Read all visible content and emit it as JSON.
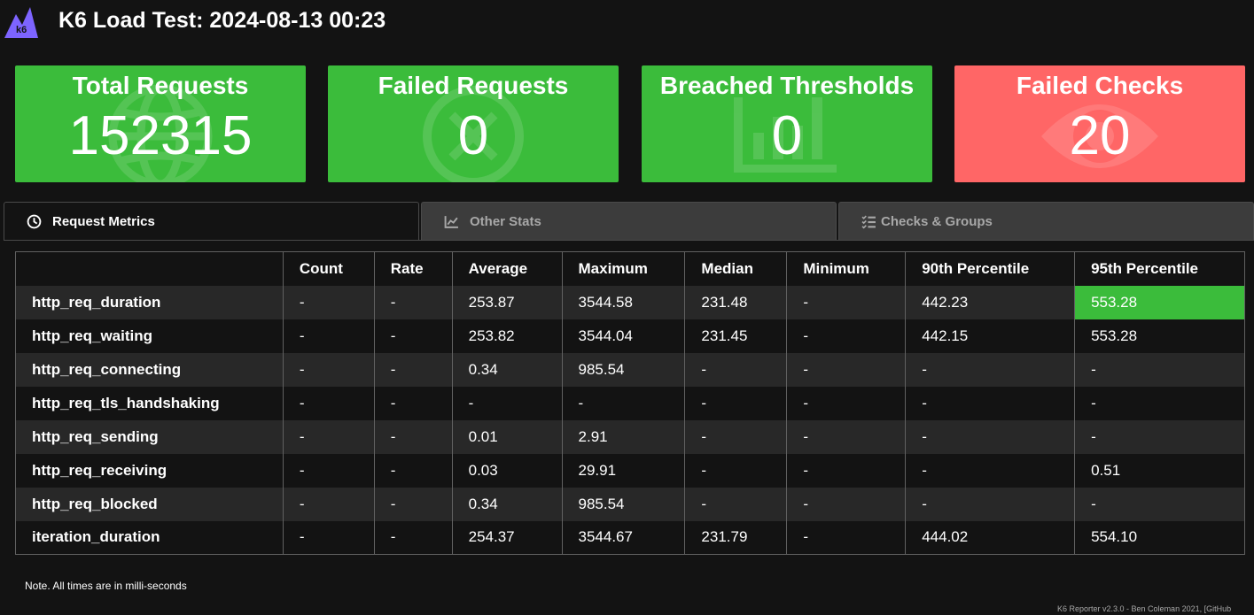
{
  "header": {
    "logo_text": "k6",
    "title": "K6 Load Test: 2024-08-13 00:23"
  },
  "cards": [
    {
      "title": "Total Requests",
      "value": "152315",
      "icon": "globe-icon",
      "status": "ok"
    },
    {
      "title": "Failed Requests",
      "value": "0",
      "icon": "x-circle-icon",
      "status": "ok"
    },
    {
      "title": "Breached Thresholds",
      "value": "0",
      "icon": "bar-chart-icon",
      "status": "ok"
    },
    {
      "title": "Failed Checks",
      "value": "20",
      "icon": "eye-icon",
      "status": "fail"
    }
  ],
  "tabs": [
    {
      "label": "Request Metrics",
      "icon": "clock-icon",
      "active": true
    },
    {
      "label": "Other Stats",
      "icon": "line-chart-icon",
      "active": false
    },
    {
      "label": "Checks & Groups",
      "icon": "checklist-icon",
      "active": false
    }
  ],
  "table": {
    "headers": [
      "",
      "Count",
      "Rate",
      "Average",
      "Maximum",
      "Median",
      "Minimum",
      "90th Percentile",
      "95th Percentile"
    ],
    "rows": [
      [
        "http_req_duration",
        "-",
        "-",
        "253.87",
        "3544.58",
        "231.48",
        "-",
        "442.23",
        "553.28"
      ],
      [
        "http_req_waiting",
        "-",
        "-",
        "253.82",
        "3544.04",
        "231.45",
        "-",
        "442.15",
        "553.28"
      ],
      [
        "http_req_connecting",
        "-",
        "-",
        "0.34",
        "985.54",
        "-",
        "-",
        "-",
        "-"
      ],
      [
        "http_req_tls_handshaking",
        "-",
        "-",
        "-",
        "-",
        "-",
        "-",
        "-",
        "-"
      ],
      [
        "http_req_sending",
        "-",
        "-",
        "0.01",
        "2.91",
        "-",
        "-",
        "-",
        "-"
      ],
      [
        "http_req_receiving",
        "-",
        "-",
        "0.03",
        "29.91",
        "-",
        "-",
        "-",
        "0.51"
      ],
      [
        "http_req_blocked",
        "-",
        "-",
        "0.34",
        "985.54",
        "-",
        "-",
        "-",
        "-"
      ],
      [
        "iteration_duration",
        "-",
        "-",
        "254.37",
        "3544.67",
        "231.79",
        "-",
        "444.02",
        "554.10"
      ]
    ]
  },
  "note": "Note. All times are in milli-seconds",
  "footer": "K6 Reporter v2.3.0 - Ben Coleman 2021, [GitHub",
  "colors": {
    "ok": "#3bbc3b",
    "fail": "#ff6666",
    "background": "#131313",
    "logo": "#7d64ff"
  }
}
